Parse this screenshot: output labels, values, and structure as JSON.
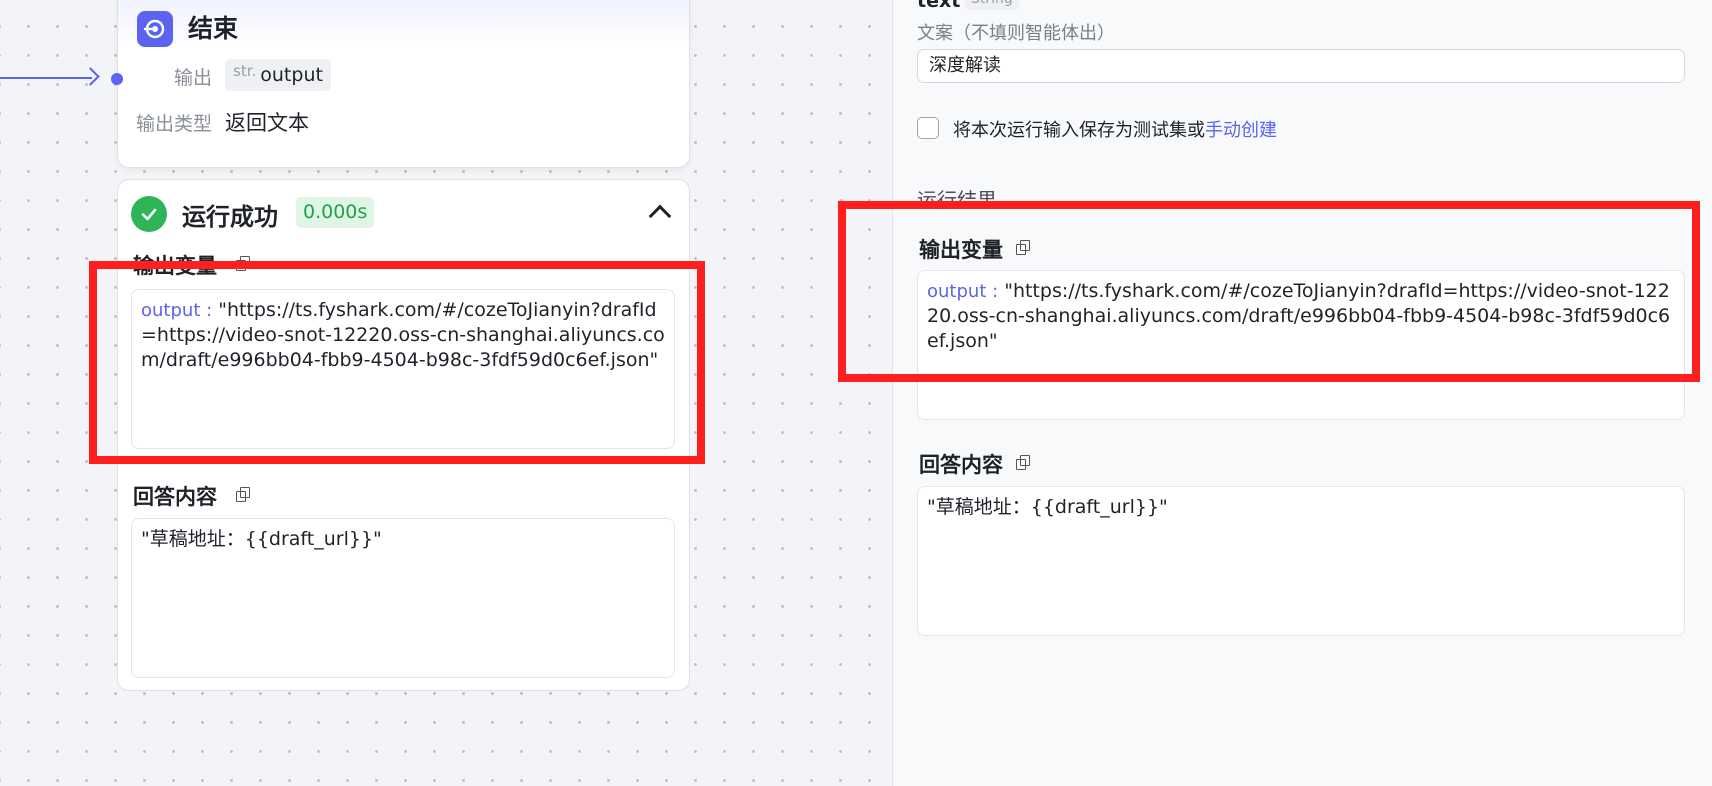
{
  "node": {
    "title": "结束",
    "output_label": "输出",
    "output_tag_type": "str.",
    "output_tag_name": "output",
    "output_type_label": "输出类型",
    "output_type_value": "返回文本"
  },
  "result": {
    "status": "运行成功",
    "time": "0.000s",
    "output_vars_label": "输出变量",
    "output_key": "output :",
    "output_value": "\"https://ts.fyshark.com/#/cozeToJianyin?drafId=https://video-snot-12220.oss-cn-shanghai.aliyuncs.com/draft/e996bb04-fbb9-4504-b98c-3fdf59d0c6ef.json\"",
    "answer_label": "回答内容",
    "answer_value": "\"草稿地址：{{draft_url}}\""
  },
  "panel": {
    "cut_field_name": "text",
    "cut_field_type": "String",
    "field_label": "文案（不填则智能体出）",
    "field_value": "深度解读",
    "save_checkbox_label": "将本次运行输入保存为测试集或",
    "save_link": "手动创建",
    "results_heading": "运行结果",
    "output_vars_label": "输出变量",
    "output_key": "output :",
    "output_value": "\"https://ts.fyshark.com/#/cozeToJianyin?drafId=https://video-snot-12220.oss-cn-shanghai.aliyuncs.com/draft/e996bb04-fbb9-4504-b98c-3fdf59d0c6ef.json\"",
    "answer_label": "回答内容",
    "answer_value": "\"草稿地址：{{draft_url}}\""
  },
  "colors": {
    "accent": "#5b63f0",
    "success": "#2fb457",
    "highlight": "#ff1f1f"
  }
}
